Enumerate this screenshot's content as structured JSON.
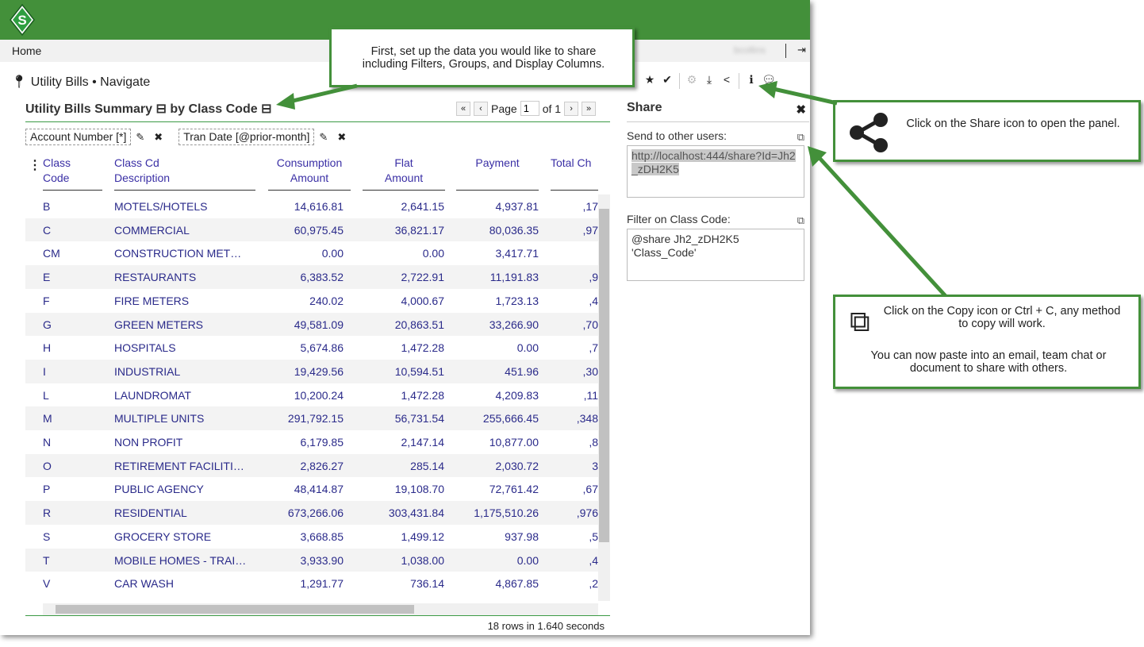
{
  "nav": {
    "home": "Home",
    "user": "bcollins"
  },
  "breadcrumb": "Utility Bills • Navigate",
  "title": {
    "part1": "Utility Bills Summary",
    "part2": "by Class Code",
    "collapse": "⊟"
  },
  "pager": {
    "first": "«",
    "prev": "‹",
    "page_label": "Page",
    "page": "1",
    "of": "of 1",
    "next": "›",
    "last": "»"
  },
  "filters": [
    {
      "label": "Account Number [*]"
    },
    {
      "label": "Tran Date [@prior-month]"
    }
  ],
  "columns": [
    {
      "l1": "Class",
      "l2": "Code"
    },
    {
      "l1": "Class Cd",
      "l2": "Description"
    },
    {
      "l1": "Consumption",
      "l2": "Amount"
    },
    {
      "l1": "Flat",
      "l2": "Amount"
    },
    {
      "l1": "",
      "l2": "Payment"
    },
    {
      "l1": "",
      "l2": "Total Ch"
    }
  ],
  "rows": [
    [
      "B",
      "MOTELS/HOTELS",
      "14,616.81",
      "2,641.15",
      "4,937.81",
      "17,"
    ],
    [
      "C",
      "COMMERCIAL",
      "60,975.45",
      "36,821.17",
      "80,036.35",
      "97,"
    ],
    [
      "CM",
      "CONSTRUCTION MET…",
      "0.00",
      "0.00",
      "3,417.71",
      ""
    ],
    [
      "E",
      "RESTAURANTS",
      "6,383.52",
      "2,722.91",
      "11,191.83",
      "9,"
    ],
    [
      "F",
      "FIRE METERS",
      "240.02",
      "4,000.67",
      "1,723.13",
      "4,"
    ],
    [
      "G",
      "GREEN METERS",
      "49,581.09",
      "20,863.51",
      "33,266.90",
      "70,"
    ],
    [
      "H",
      "HOSPITALS",
      "5,674.86",
      "1,472.28",
      "0.00",
      "7,"
    ],
    [
      "I",
      "INDUSTRIAL",
      "19,429.56",
      "10,594.51",
      "451.96",
      "30,"
    ],
    [
      "L",
      "LAUNDROMAT",
      "10,200.24",
      "1,472.28",
      "4,209.83",
      "11,"
    ],
    [
      "M",
      "MULTIPLE UNITS",
      "291,792.15",
      "56,731.54",
      "255,666.45",
      "348,"
    ],
    [
      "N",
      "NON PROFIT",
      "6,179.85",
      "2,147.14",
      "10,877.00",
      "8,"
    ],
    [
      "O",
      "RETIREMENT FACILITI…",
      "2,826.27",
      "285.14",
      "2,030.72",
      "3"
    ],
    [
      "P",
      "PUBLIC AGENCY",
      "48,414.87",
      "19,108.70",
      "72,761.42",
      "67,"
    ],
    [
      "R",
      "RESIDENTIAL",
      "673,266.06",
      "303,431.84",
      "1,175,510.26",
      "976,"
    ],
    [
      "S",
      "GROCERY STORE",
      "3,668.85",
      "1,499.12",
      "937.98",
      "5,"
    ],
    [
      "T",
      "MOBILE HOMES - TRAI…",
      "3,933.90",
      "1,038.00",
      "0.00",
      "4,"
    ],
    [
      "V",
      "CAR WASH",
      "1,291.77",
      "736.14",
      "4,867.85",
      "2,"
    ]
  ],
  "footer": "18 rows in 1.640 seconds",
  "share": {
    "title": "Share",
    "send_label": "Send to other users:",
    "url": "http://localhost:444/share?Id=Jh2_zDH2K5",
    "filter_label": "Filter on Class Code:",
    "filter_value": "@share Jh2_zDH2K5 'Class_Code'"
  },
  "callouts": {
    "setup": "First, set up the data you would like to share including Filters, Groups, and Display Columns.",
    "share_icon": "Click on the Share icon to open the panel.",
    "copy_l1": "Click on the Copy icon or Ctrl + C, any method to copy will work.",
    "copy_l2": "You can now paste into an email, team chat or document to share with others."
  },
  "colors": {
    "brand_green": "#43903a",
    "link": "#3a2fa5"
  }
}
